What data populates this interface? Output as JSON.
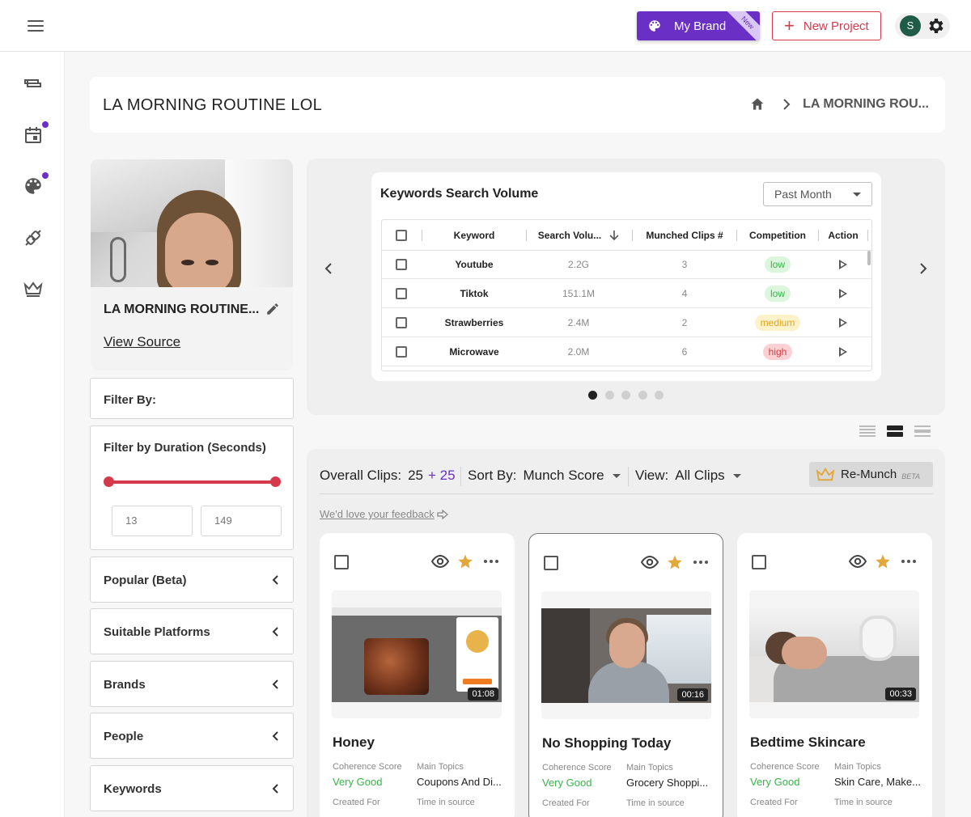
{
  "topbar": {
    "brand_label": "My Brand",
    "brand_ribbon": "New",
    "new_project_label": "New Project",
    "avatar_initial": "S",
    "brand_color": "#6a2fc4",
    "accent_red": "#d53a4c"
  },
  "header": {
    "title": "LA MORNING ROUTINE LOL",
    "breadcrumb_current": "LA MORNING ROU..."
  },
  "project": {
    "name": "LA MORNING ROUTINE...",
    "view_source": "View Source"
  },
  "filters": {
    "filter_by": "Filter By:",
    "duration_label": "Filter by Duration (Seconds)",
    "duration_min": "13",
    "duration_max": "149",
    "sections": [
      "Popular (Beta)",
      "Suitable Platforms",
      "Brands",
      "People",
      "Keywords"
    ]
  },
  "keywords": {
    "title": "Keywords Search Volume",
    "period": "Past Month",
    "columns": [
      "Keyword",
      "Search Volu...",
      "Munched Clips #",
      "Competition",
      "Action"
    ],
    "rows": [
      {
        "keyword": "Youtube",
        "volume": "2.2G",
        "clips": "3",
        "competition": "low"
      },
      {
        "keyword": "Tiktok",
        "volume": "151.1M",
        "clips": "4",
        "competition": "low"
      },
      {
        "keyword": "Strawberries",
        "volume": "2.4M",
        "clips": "2",
        "competition": "medium"
      },
      {
        "keyword": "Microwave",
        "volume": "2.0M",
        "clips": "6",
        "competition": "high"
      }
    ],
    "carousel_pages": 5,
    "carousel_active": 1
  },
  "clips_toolbar": {
    "overall_label": "Overall Clips:",
    "overall_count": "25",
    "overall_plus": "+ 25",
    "sort_label": "Sort By:",
    "sort_value": "Munch Score",
    "view_label": "View:",
    "view_value": "All Clips",
    "remunch_label": "Re-Munch",
    "remunch_badge": "BETA",
    "feedback": "We'd love your feedback"
  },
  "clips": [
    {
      "title": "Honey",
      "duration": "01:08",
      "coherence_label": "Coherence Score",
      "coherence": "Very Good",
      "topics_label": "Main Topics",
      "topics": "Coupons And Di...",
      "created_label": "Created For",
      "time_label": "Time in source"
    },
    {
      "title": "No Shopping Today",
      "duration": "00:16",
      "coherence_label": "Coherence Score",
      "coherence": "Very Good",
      "topics_label": "Main Topics",
      "topics": "Grocery Shoppi...",
      "created_label": "Created For",
      "time_label": "Time in source"
    },
    {
      "title": "Bedtime Skincare",
      "duration": "00:33",
      "coherence_label": "Coherence Score",
      "coherence": "Very Good",
      "topics_label": "Main Topics",
      "topics": "Skin Care, Make...",
      "created_label": "Created For",
      "time_label": "Time in source"
    }
  ]
}
